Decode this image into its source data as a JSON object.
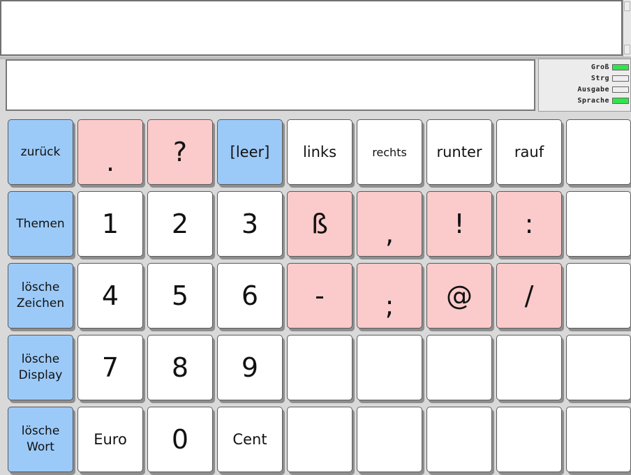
{
  "status": [
    {
      "label": "Groß",
      "on": true
    },
    {
      "label": "Strg",
      "on": false
    },
    {
      "label": "Ausgabe",
      "on": false
    },
    {
      "label": "Sprache",
      "on": true
    }
  ],
  "keys": [
    [
      {
        "label": "zurück",
        "type": "nav",
        "size": "ctl"
      },
      {
        "label": ".",
        "type": "pink",
        "size": "big"
      },
      {
        "label": "?",
        "type": "pink",
        "size": "big"
      },
      {
        "label": "[leer]",
        "type": "nav",
        "size": "word"
      },
      {
        "label": "links",
        "type": "plain",
        "size": "word"
      },
      {
        "label": "rechts",
        "type": "plain",
        "size": "sm"
      },
      {
        "label": "runter",
        "type": "plain",
        "size": "word"
      },
      {
        "label": "rauf",
        "type": "plain",
        "size": "word"
      },
      {
        "label": "",
        "type": "plain",
        "size": "word"
      }
    ],
    [
      {
        "label": "Themen",
        "type": "nav",
        "size": "ctl"
      },
      {
        "label": "1",
        "type": "plain",
        "size": "big"
      },
      {
        "label": "2",
        "type": "plain",
        "size": "big"
      },
      {
        "label": "3",
        "type": "plain",
        "size": "big"
      },
      {
        "label": "ß",
        "type": "pink",
        "size": "big"
      },
      {
        "label": ",",
        "type": "pink",
        "size": "big"
      },
      {
        "label": "!",
        "type": "pink",
        "size": "big"
      },
      {
        "label": ":",
        "type": "pink",
        "size": "big"
      },
      {
        "label": "",
        "type": "plain",
        "size": "word"
      }
    ],
    [
      {
        "label": "lösche\nZeichen",
        "type": "nav",
        "size": "ctl"
      },
      {
        "label": "4",
        "type": "plain",
        "size": "big"
      },
      {
        "label": "5",
        "type": "plain",
        "size": "big"
      },
      {
        "label": "6",
        "type": "plain",
        "size": "big"
      },
      {
        "label": "-",
        "type": "pink",
        "size": "big"
      },
      {
        "label": ";",
        "type": "pink",
        "size": "big"
      },
      {
        "label": "@",
        "type": "pink",
        "size": "big"
      },
      {
        "label": "/",
        "type": "pink",
        "size": "big"
      },
      {
        "label": "",
        "type": "plain",
        "size": "word"
      }
    ],
    [
      {
        "label": "lösche\nDisplay",
        "type": "nav",
        "size": "ctl"
      },
      {
        "label": "7",
        "type": "plain",
        "size": "big"
      },
      {
        "label": "8",
        "type": "plain",
        "size": "big"
      },
      {
        "label": "9",
        "type": "plain",
        "size": "big"
      },
      {
        "label": "",
        "type": "plain",
        "size": "word"
      },
      {
        "label": "",
        "type": "plain",
        "size": "word"
      },
      {
        "label": "",
        "type": "plain",
        "size": "word"
      },
      {
        "label": "",
        "type": "plain",
        "size": "word"
      },
      {
        "label": "",
        "type": "plain",
        "size": "word"
      }
    ],
    [
      {
        "label": "lösche\nWort",
        "type": "nav",
        "size": "ctl"
      },
      {
        "label": "Euro",
        "type": "plain",
        "size": "word"
      },
      {
        "label": "0",
        "type": "plain",
        "size": "big"
      },
      {
        "label": "Cent",
        "type": "plain",
        "size": "word"
      },
      {
        "label": "",
        "type": "plain",
        "size": "word"
      },
      {
        "label": "",
        "type": "plain",
        "size": "word"
      },
      {
        "label": "",
        "type": "plain",
        "size": "word"
      },
      {
        "label": "",
        "type": "plain",
        "size": "word"
      },
      {
        "label": "",
        "type": "plain",
        "size": "word"
      }
    ]
  ]
}
